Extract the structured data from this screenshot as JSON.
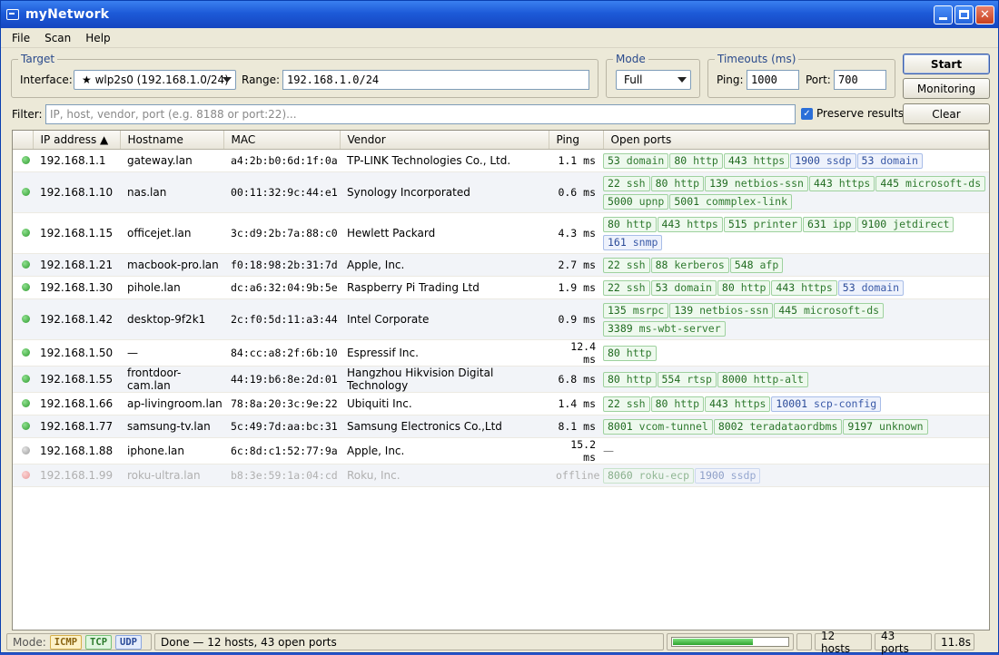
{
  "app": {
    "title": "myNetwork"
  },
  "menu": [
    "File",
    "Scan",
    "Help"
  ],
  "target": {
    "legend": "Target",
    "interface_label": "Interface:",
    "interface_value": "★ wlp2s0 (192.168.1.0/24)",
    "range_label": "Range:",
    "range_value": "192.168.1.0/24"
  },
  "mode": {
    "legend": "Mode",
    "value": "Full"
  },
  "timeouts": {
    "legend": "Timeouts (ms)",
    "ping_label": "Ping:",
    "ping_value": "1000",
    "port_label": "Port:",
    "port_value": "700"
  },
  "buttons": {
    "start": "Start",
    "monitoring": "Monitoring",
    "clear": "Clear"
  },
  "filter": {
    "label": "Filter:",
    "placeholder": "IP, host, vendor, port (e.g. 8188 or port:22)...",
    "preserve_label": "Preserve results",
    "preserve_checked": true
  },
  "columns": [
    "",
    "IP address ▲",
    "Hostname",
    "MAC",
    "Vendor",
    "Ping",
    "Open ports"
  ],
  "hosts": [
    {
      "status": "up",
      "ip": "192.168.1.1",
      "host": "gateway.lan",
      "mac": "a4:2b:b0:6d:1f:0a",
      "vendor": "TP-LINK Technologies Co., Ltd.",
      "ping": "1.1 ms",
      "ports": [
        {
          "n": "53",
          "s": "domain",
          "p": "tcp"
        },
        {
          "n": "80",
          "s": "http",
          "p": "tcp"
        },
        {
          "n": "443",
          "s": "https",
          "p": "tcp"
        },
        {
          "n": "1900",
          "s": "ssdp",
          "p": "udp"
        },
        {
          "n": "53",
          "s": "domain",
          "p": "udp"
        }
      ]
    },
    {
      "status": "up",
      "ip": "192.168.1.10",
      "host": "nas.lan",
      "mac": "00:11:32:9c:44:e1",
      "vendor": "Synology Incorporated",
      "ping": "0.6 ms",
      "ports": [
        {
          "n": "22",
          "s": "ssh",
          "p": "tcp"
        },
        {
          "n": "80",
          "s": "http",
          "p": "tcp"
        },
        {
          "n": "139",
          "s": "netbios-ssn",
          "p": "tcp"
        },
        {
          "n": "443",
          "s": "https",
          "p": "tcp"
        },
        {
          "n": "445",
          "s": "microsoft-ds",
          "p": "tcp"
        },
        {
          "n": "5000",
          "s": "upnp",
          "p": "tcp"
        },
        {
          "n": "5001",
          "s": "commplex-link",
          "p": "tcp"
        }
      ]
    },
    {
      "status": "up",
      "ip": "192.168.1.15",
      "host": "officejet.lan",
      "mac": "3c:d9:2b:7a:88:c0",
      "vendor": "Hewlett Packard",
      "ping": "4.3 ms",
      "ports": [
        {
          "n": "80",
          "s": "http",
          "p": "tcp"
        },
        {
          "n": "443",
          "s": "https",
          "p": "tcp"
        },
        {
          "n": "515",
          "s": "printer",
          "p": "tcp"
        },
        {
          "n": "631",
          "s": "ipp",
          "p": "tcp"
        },
        {
          "n": "9100",
          "s": "jetdirect",
          "p": "tcp"
        },
        {
          "n": "161",
          "s": "snmp",
          "p": "udp"
        }
      ]
    },
    {
      "status": "up",
      "ip": "192.168.1.21",
      "host": "macbook-pro.lan",
      "mac": "f0:18:98:2b:31:7d",
      "vendor": "Apple, Inc.",
      "ping": "2.7 ms",
      "ports": [
        {
          "n": "22",
          "s": "ssh",
          "p": "tcp"
        },
        {
          "n": "88",
          "s": "kerberos",
          "p": "tcp"
        },
        {
          "n": "548",
          "s": "afp",
          "p": "tcp"
        }
      ]
    },
    {
      "status": "up",
      "ip": "192.168.1.30",
      "host": "pihole.lan",
      "mac": "dc:a6:32:04:9b:5e",
      "vendor": "Raspberry Pi Trading Ltd",
      "ping": "1.9 ms",
      "ports": [
        {
          "n": "22",
          "s": "ssh",
          "p": "tcp"
        },
        {
          "n": "53",
          "s": "domain",
          "p": "tcp"
        },
        {
          "n": "80",
          "s": "http",
          "p": "tcp"
        },
        {
          "n": "443",
          "s": "https",
          "p": "tcp"
        },
        {
          "n": "53",
          "s": "domain",
          "p": "udp"
        }
      ]
    },
    {
      "status": "up",
      "ip": "192.168.1.42",
      "host": "desktop-9f2k1",
      "mac": "2c:f0:5d:11:a3:44",
      "vendor": "Intel Corporate",
      "ping": "0.9 ms",
      "ports": [
        {
          "n": "135",
          "s": "msrpc",
          "p": "tcp"
        },
        {
          "n": "139",
          "s": "netbios-ssn",
          "p": "tcp"
        },
        {
          "n": "445",
          "s": "microsoft-ds",
          "p": "tcp"
        },
        {
          "n": "3389",
          "s": "ms-wbt-server",
          "p": "tcp"
        }
      ]
    },
    {
      "status": "up",
      "ip": "192.168.1.50",
      "host": "—",
      "mac": "84:cc:a8:2f:6b:10",
      "vendor": "Espressif Inc.",
      "ping": "12.4 ms",
      "ports": [
        {
          "n": "80",
          "s": "http",
          "p": "tcp"
        }
      ]
    },
    {
      "status": "up",
      "ip": "192.168.1.55",
      "host": "frontdoor-cam.lan",
      "mac": "44:19:b6:8e:2d:01",
      "vendor": "Hangzhou Hikvision Digital Technology",
      "ping": "6.8 ms",
      "ports": [
        {
          "n": "80",
          "s": "http",
          "p": "tcp"
        },
        {
          "n": "554",
          "s": "rtsp",
          "p": "tcp"
        },
        {
          "n": "8000",
          "s": "http-alt",
          "p": "tcp"
        }
      ]
    },
    {
      "status": "up",
      "ip": "192.168.1.66",
      "host": "ap-livingroom.lan",
      "mac": "78:8a:20:3c:9e:22",
      "vendor": "Ubiquiti Inc.",
      "ping": "1.4 ms",
      "ports": [
        {
          "n": "22",
          "s": "ssh",
          "p": "tcp"
        },
        {
          "n": "80",
          "s": "http",
          "p": "tcp"
        },
        {
          "n": "443",
          "s": "https",
          "p": "tcp"
        },
        {
          "n": "10001",
          "s": "scp-config",
          "p": "udp"
        }
      ]
    },
    {
      "status": "up",
      "ip": "192.168.1.77",
      "host": "samsung-tv.lan",
      "mac": "5c:49:7d:aa:bc:31",
      "vendor": "Samsung Electronics Co.,Ltd",
      "ping": "8.1 ms",
      "ports": [
        {
          "n": "8001",
          "s": "vcom-tunnel",
          "p": "tcp"
        },
        {
          "n": "8002",
          "s": "teradataordbms",
          "p": "tcp"
        },
        {
          "n": "9197",
          "s": "unknown",
          "p": "tcp"
        }
      ]
    },
    {
      "status": "gray",
      "ip": "192.168.1.88",
      "host": "iphone.lan",
      "mac": "6c:8d:c1:52:77:9a",
      "vendor": "Apple, Inc.",
      "ping": "15.2 ms",
      "ports_text": "—",
      "ports": []
    },
    {
      "status": "off",
      "ip": "192.168.1.99",
      "host": "roku-ultra.lan",
      "mac": "b8:3e:59:1a:04:cd",
      "vendor": "Roku, Inc.",
      "ping": "offline",
      "ports": [
        {
          "n": "8060",
          "s": "roku-ecp",
          "p": "tcp"
        },
        {
          "n": "1900",
          "s": "ssdp",
          "p": "udp"
        }
      ]
    }
  ],
  "status": {
    "mode_label": "Mode:",
    "chips": [
      "ICMP",
      "TCP",
      "UDP"
    ],
    "message": "Done — 12 hosts, 43 open ports",
    "progress": 0.7,
    "hosts": "12 hosts",
    "ports": "43 ports",
    "time": "11.8s"
  }
}
